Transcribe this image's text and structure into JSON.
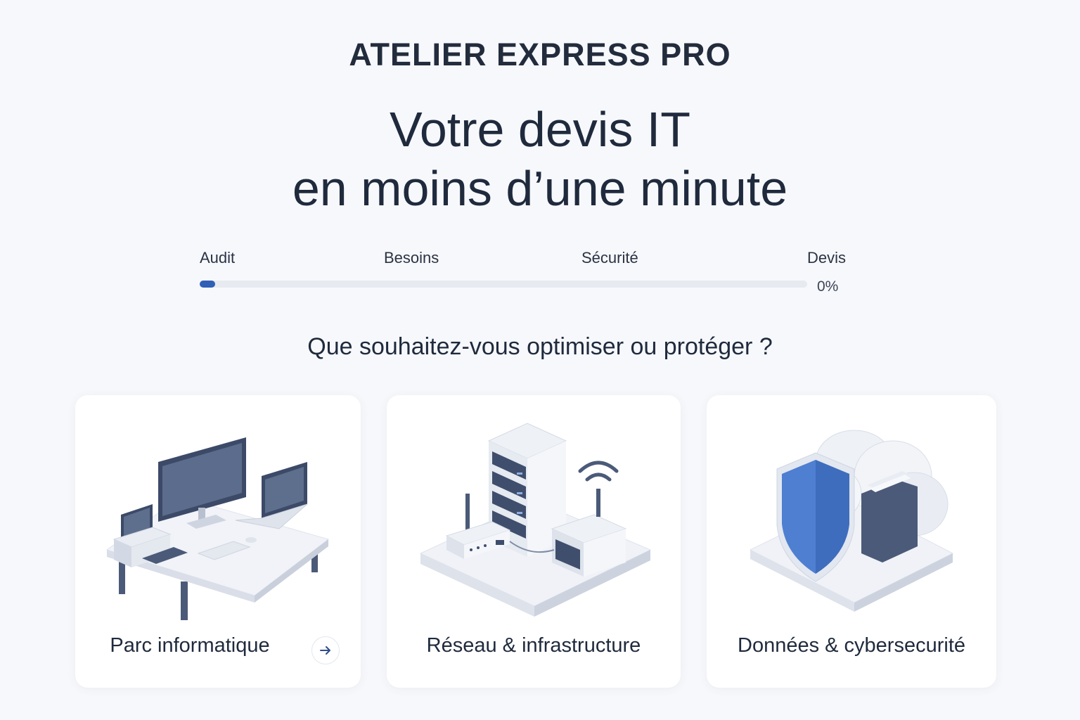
{
  "brand": "ATELIER EXPRESS PRO",
  "headline": {
    "line1": "Votre devis IT",
    "line2": "en moins d’une minute"
  },
  "steps": [
    "Audit",
    "Besoins",
    "Sécurité",
    "Devis"
  ],
  "progress": {
    "value": 0,
    "label": "0%"
  },
  "question": "Que souhaitez-vous optimiser ou protéger ?",
  "cards": [
    {
      "label": "Parc informatique",
      "icon": "workstation-desk-icon"
    },
    {
      "label": "Réseau & infrastructure",
      "icon": "server-network-icon"
    },
    {
      "label": "Données & cybersecurité",
      "icon": "shield-cloud-icon"
    }
  ],
  "colors": {
    "accent": "#2f5fb6",
    "shield": "#4f7fd0",
    "text": "#1f2a3d",
    "background": "#f7f8fb"
  }
}
